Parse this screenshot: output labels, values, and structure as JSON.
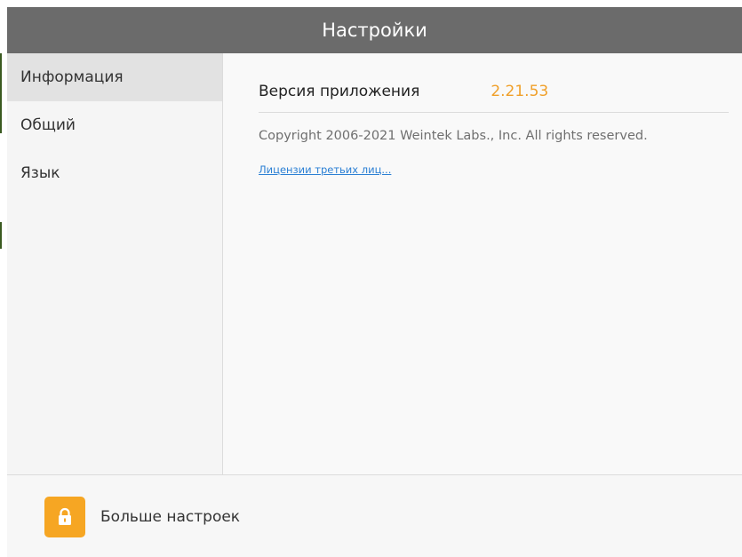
{
  "window": {
    "title": "Настройки"
  },
  "sidebar": {
    "items": [
      {
        "label": "Информация",
        "active": true
      },
      {
        "label": "Общий",
        "active": false
      },
      {
        "label": "Язык",
        "active": false
      }
    ]
  },
  "info": {
    "version_label": "Версия приложения",
    "version_value": "2.21.53",
    "copyright": "Copyright 2006-2021 Weintek Labs., Inc. All rights reserved.",
    "licenses_link": "Лицензии третьих лиц..."
  },
  "footer": {
    "more_settings_label": "Больше настроек",
    "more_settings_icon": "lock-icon"
  },
  "colors": {
    "titlebar": "#6b6b6b",
    "accent_orange": "#f6a623",
    "version_value": "#f0a02a",
    "link": "#2a7fd4",
    "active_item_bg": "#e2e2e2"
  }
}
